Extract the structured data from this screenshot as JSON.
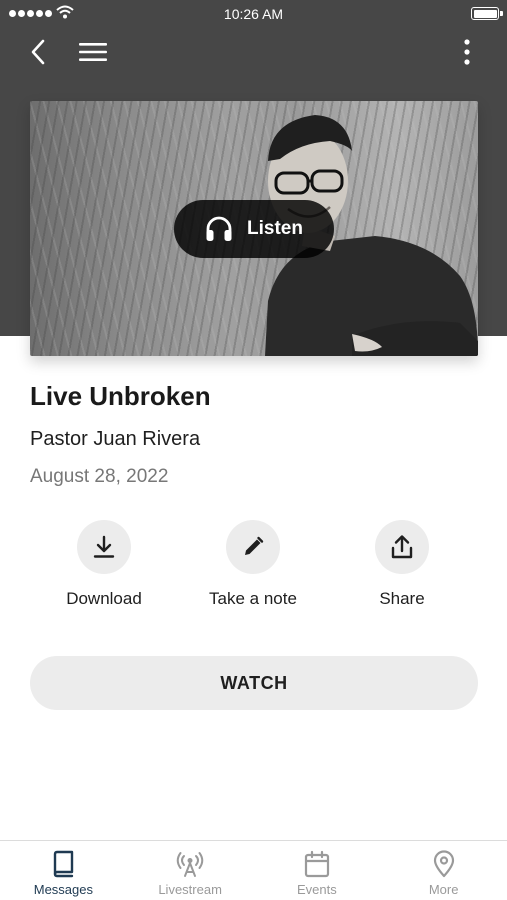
{
  "status_bar": {
    "time": "10:26 AM",
    "signal_dots": 5,
    "battery_level": 1.0
  },
  "nav": {
    "icons": [
      "back-icon",
      "menu-icon",
      "more-vertical-icon"
    ]
  },
  "hero": {
    "listen_label": "Listen",
    "listen_icon": "headphones-icon"
  },
  "message": {
    "title": "Live Unbroken",
    "speaker": "Pastor Juan Rivera",
    "date": "August 28, 2022"
  },
  "actions": [
    {
      "label": "Download",
      "icon": "download-icon"
    },
    {
      "label": "Take a note",
      "icon": "pencil-icon"
    },
    {
      "label": "Share",
      "icon": "share-icon"
    }
  ],
  "watch_label": "WATCH",
  "tabs": [
    {
      "label": "Messages",
      "icon": "book-icon",
      "active": true
    },
    {
      "label": "Livestream",
      "icon": "broadcast-icon",
      "active": false
    },
    {
      "label": "Events",
      "icon": "calendar-icon",
      "active": false
    },
    {
      "label": "More",
      "icon": "location-pin-icon",
      "active": false
    }
  ],
  "colors": {
    "header_background": "#474747",
    "active_tab": "#1f3a52",
    "inactive_tab": "#9a9a9a",
    "button_background": "#ececec"
  }
}
